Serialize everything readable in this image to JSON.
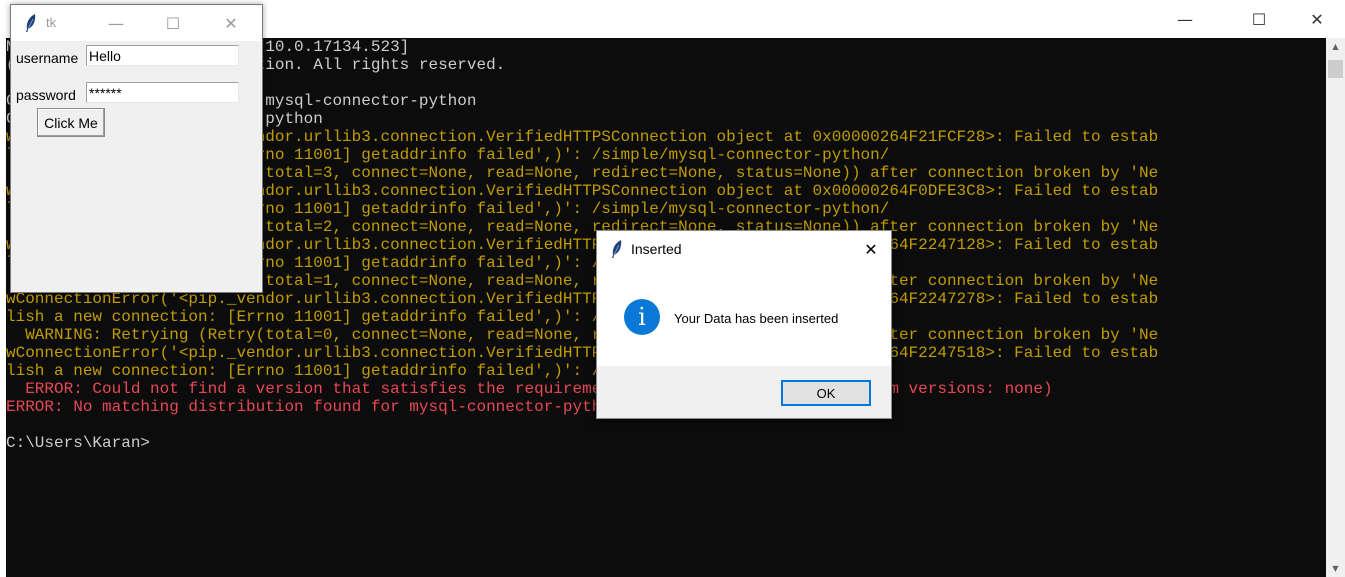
{
  "console": {
    "controls": {
      "minimize": "—",
      "maximize": "☐",
      "close": "✕"
    },
    "lines": [
      {
        "text": "Microsoft Windows [Version 10.0.17134.523]",
        "style": "n"
      },
      {
        "text": "(c) 2018 Microsoft Corporation. All rights reserved.",
        "style": "n"
      },
      {
        "text": "",
        "style": "n"
      },
      {
        "text": "C:\\Users\\Karan>pip install mysql-connector-python",
        "style": "n"
      },
      {
        "text": "Collecting mysql-connector-python",
        "style": "n"
      },
      {
        "text": "  WARNING: Retrying (Retry(total=4, connect=None, read=None, redirect=None, status=None)) after connection broken by 'NewConnectionError('<pip._vendor.urllib3.connection.VerifiedHTTPSConnection object at 0x00000264F21FCF28>: Failed to establish a new connection: [Errno 11001] getaddrinfo failed',)': /simple/mysql-connector-python/",
        "style": "w",
        "wrap": true
      },
      {
        "text": "wConnectionError('<pip._vendor.urllib3.connection.VerifiedHTTPSConnection object at 0x00000264F21FCF28>: Failed to estab",
        "style": "w"
      },
      {
        "text": "lish a new connection: [Errno 11001] getaddrinfo failed',)': /simple/mysql-connector-python/",
        "style": "w"
      },
      {
        "text": "  WARNING: Retrying (Retry(total=3, connect=None, read=None, redirect=None, status=None)) after connection broken by 'Ne",
        "style": "w"
      },
      {
        "text": "wConnectionError('<pip._vendor.urllib3.connection.VerifiedHTTPSConnection object at 0x00000264F0DFE3C8>: Failed to estab",
        "style": "w"
      },
      {
        "text": "lish a new connection: [Errno 11001] getaddrinfo failed',)': /simple/mysql-connector-python/",
        "style": "w"
      },
      {
        "text": "  WARNING: Retrying (Retry(total=2, connect=None, read=None, redirect=None, status=None)) after connection broken by 'Ne",
        "style": "w"
      },
      {
        "text": "wConnectionError('<pip._vendor.urllib3.connection.VerifiedHTTPSConnection object at 0x00000264F2247128>: Failed to estab",
        "style": "w"
      },
      {
        "text": "lish a new connection: [Errno 11001] getaddrinfo failed',)': /simple/mysql-connector-python/",
        "style": "w"
      },
      {
        "text": "  WARNING: Retrying (Retry(total=1, connect=None, read=None, redirect=None, status=None)) after connection broken by 'Ne",
        "style": "w"
      },
      {
        "text": "wConnectionError('<pip._vendor.urllib3.connection.VerifiedHTTPSConnection object at 0x00000264F2247278>: Failed to estab",
        "style": "w"
      },
      {
        "text": "lish a new connection: [Errno 11001] getaddrinfo failed',)': /simple/mysql-connector-python/",
        "style": "w"
      },
      {
        "text": "  WARNING: Retrying (Retry(total=0, connect=None, read=None, redirect=None, status=None)) after connection broken by 'Ne",
        "style": "w"
      },
      {
        "text": "wConnectionError('<pip._vendor.urllib3.connection.VerifiedHTTPSConnection object at 0x00000264F2247518>: Failed to estab",
        "style": "w"
      },
      {
        "text": "lish a new connection: [Errno 11001] getaddrinfo failed',)': /simple/mysql-connector-python/",
        "style": "w"
      },
      {
        "text": "  ERROR: Could not find a version that satisfies the requirement mysql-connector-python (from versions: none)",
        "style": "e"
      },
      {
        "text": "ERROR: No matching distribution found for mysql-connector-python",
        "style": "e"
      },
      {
        "text": "",
        "style": "n"
      },
      {
        "text": "C:\\Users\\Karan>",
        "style": "n"
      }
    ]
  },
  "tk_window": {
    "title": "tk",
    "controls": {
      "minimize": "—",
      "maximize": "☐",
      "close": "✕"
    },
    "username_label": "username",
    "username_value": "Hello",
    "password_label": "password",
    "password_value": "******",
    "button_label": "Click Me"
  },
  "dialog": {
    "title": "Inserted",
    "close": "✕",
    "icon_glyph": "i",
    "message": "Your Data has been inserted",
    "ok_label": "OK"
  },
  "colors": {
    "console_bg": "#0c0c0c",
    "warning": "#c19c00",
    "error": "#e74856",
    "normal": "#cccccc",
    "info_icon": "#0a78d6",
    "focus_border": "#0078d7"
  }
}
